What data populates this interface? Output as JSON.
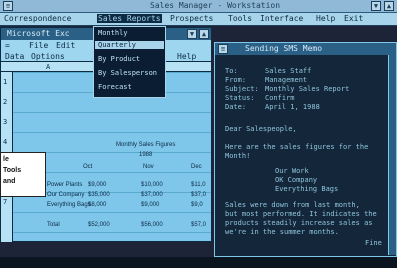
{
  "window": {
    "title": "Sales Manager - Workstation"
  },
  "menubar": {
    "items": [
      "Correspondence",
      "Sales Reports",
      "Prospects",
      "Tools",
      "Interface",
      "Help",
      "Exit"
    ]
  },
  "spreadsheet": {
    "title": "Microsoft Exc",
    "menu1": [
      "File",
      "Edit"
    ],
    "menu2": [
      "Data",
      "Options",
      "Help"
    ],
    "column_header": "A",
    "rows": [
      "1",
      "2",
      "3",
      "4",
      "5",
      "6",
      "7"
    ],
    "heading": "Monthly Sales Figures",
    "year": "1988",
    "columns": [
      "Oct",
      "Nov",
      "Dec"
    ],
    "lines": [
      {
        "label": "Power Plants",
        "values": [
          "$9,000",
          "$10,000",
          "$11,0"
        ]
      },
      {
        "label": "Our Company",
        "values": [
          "$35,000",
          "$37,000",
          "$37,0"
        ]
      },
      {
        "label": "Everything Bags",
        "values": [
          "$8,000",
          "$9,000",
          "$9,0"
        ]
      },
      {
        "label": "Total",
        "values": [
          "$52,000",
          "$56,000",
          "$57,0"
        ]
      }
    ]
  },
  "dropdown": {
    "items": [
      "Monthly",
      "Quarterly",
      "By Product",
      "By Salesperson",
      "Forecast"
    ],
    "selected_index": 1
  },
  "mail": {
    "title": "Sending SMS Memo",
    "header_labels": [
      "To:",
      "From:",
      "Subject:",
      "Status:",
      "Date:"
    ],
    "header_values": [
      "Sales Staff",
      "Management",
      "Monthly Sales Report",
      "Confirm",
      "April 1, 1988"
    ],
    "greeting": "Dear Salespeople,",
    "body1": [
      "Here are the sales figures for the",
      "Month!"
    ],
    "list": [
      "Our Work",
      "OK Company",
      "Everything Bags"
    ],
    "body2": [
      "Sales were down from last month,",
      "but most performed. It indicates the",
      "products steadily increase sales as",
      "we're in the summer months."
    ],
    "footer": "Fine"
  },
  "callout": {
    "lines": [
      "le",
      "Tools",
      "and"
    ]
  }
}
